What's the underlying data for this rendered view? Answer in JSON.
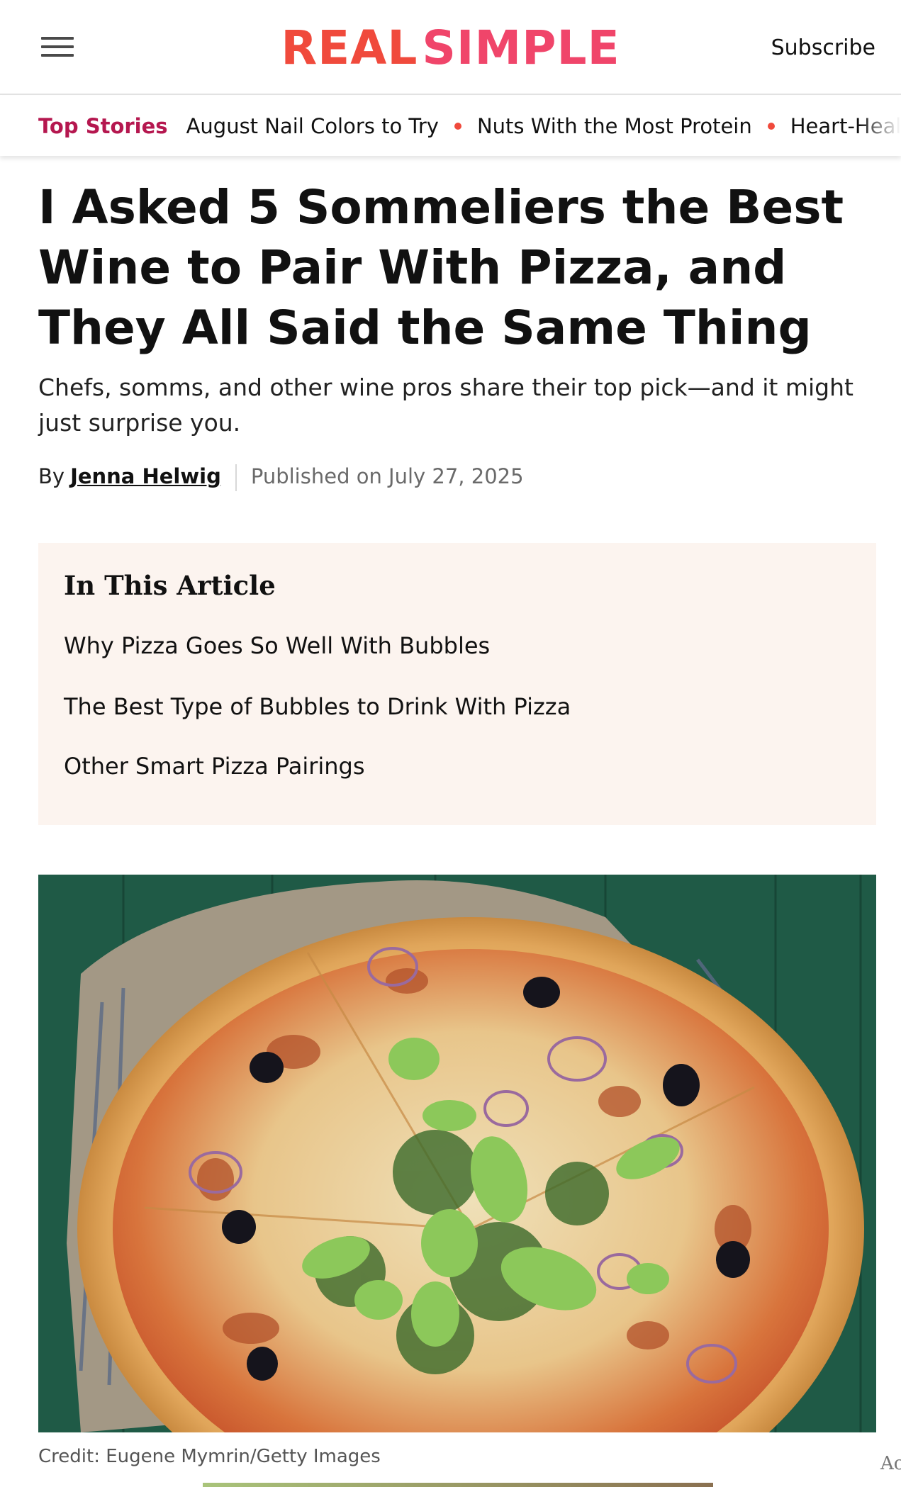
{
  "header": {
    "logo_word1": "REAL",
    "logo_word2": "SIMPLE",
    "subscribe_label": "Subscribe"
  },
  "top_stories": {
    "label": "Top Stories",
    "items": [
      "August Nail Colors to Try",
      "Nuts With the Most Protein",
      "Heart-Healt"
    ]
  },
  "article": {
    "headline": "I Asked 5 Sommeliers the Best Wine to Pair With Pizza, and They All Said the Same Thing",
    "dek": "Chefs, somms, and other wine pros share their top pick—and it might just surprise you.",
    "by_prefix": "By",
    "author": "Jenna Helwig",
    "published": "Published on July 27, 2025"
  },
  "toc": {
    "title": "In This Article",
    "items": [
      "Why Pizza Goes So Well With Bubbles",
      "The Best Type of Bubbles to Drink With Pizza",
      "Other Smart Pizza Pairings"
    ]
  },
  "image": {
    "credit": "Credit: Eugene Mymrin/Getty Images"
  },
  "ad_label": "Ac",
  "colors": {
    "logo_real": "#f04a3c",
    "logo_simple": "#f0456a",
    "top_stories_label": "#b5174f",
    "toc_background": "#fcf4ef",
    "image_background": "#1f5a46"
  }
}
